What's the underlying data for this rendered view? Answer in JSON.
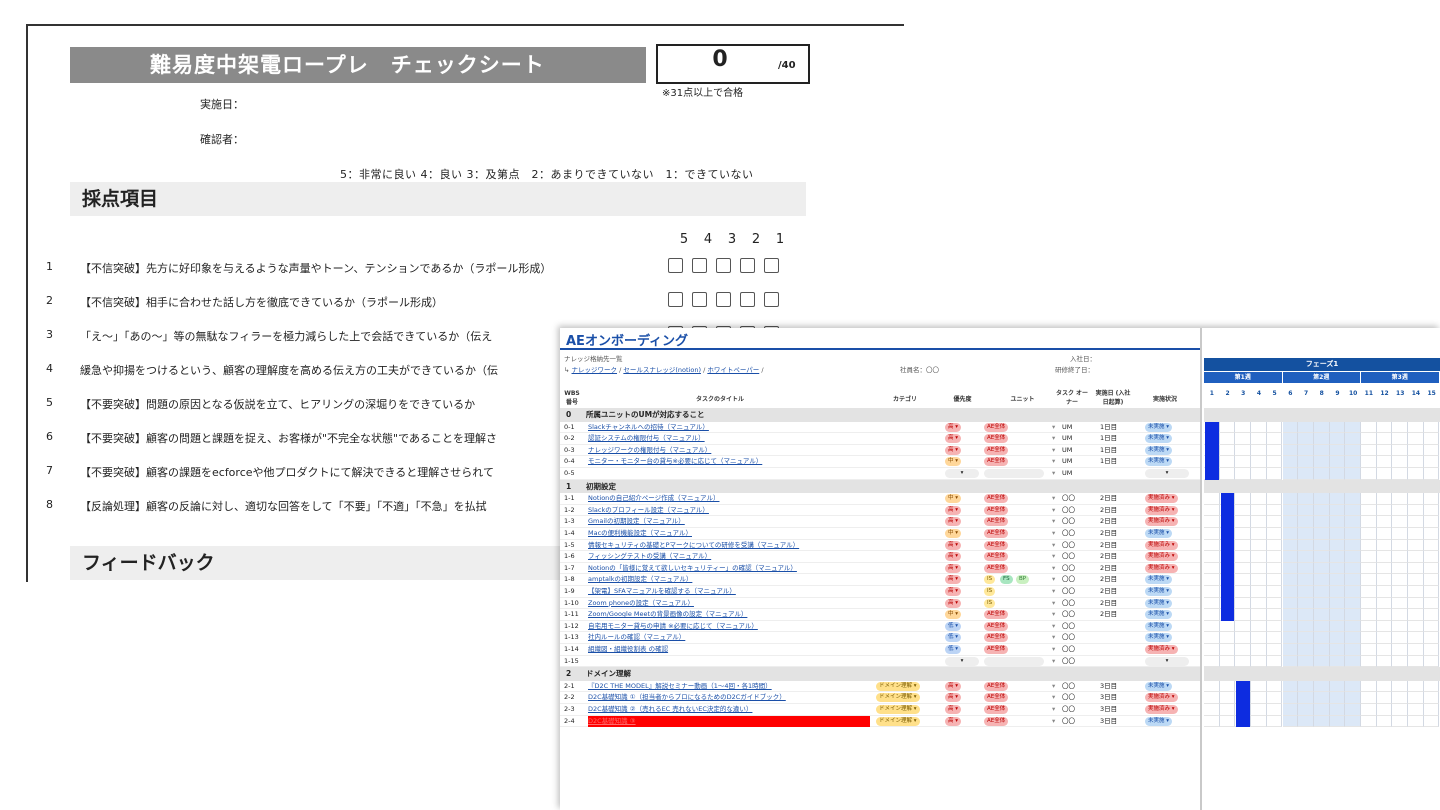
{
  "checksheet": {
    "title": "難易度中架電ロープレ　チェックシート",
    "score": "0",
    "score_max": "/40",
    "pass_note": "※31点以上で合格",
    "date_label": "実施日：",
    "checker_label": "確認者：",
    "scale_legend": "5：非常に良い 4：良い 3：及第点　2：あまりできていない　1：できていない",
    "section_scoring": "採点項目",
    "columns": [
      "5",
      "4",
      "3",
      "2",
      "1"
    ],
    "items": [
      {
        "no": "1",
        "text": "【不信突破】先方に好印象を与えるような声量やトーン、テンションであるか（ラポール形成）"
      },
      {
        "no": "2",
        "text": "【不信突破】相手に合わせた話し方を徹底できているか（ラポール形成）"
      },
      {
        "no": "3",
        "text": "「え〜」「あの〜」等の無駄なフィラーを極力減らした上で会話できているか（伝え"
      },
      {
        "no": "4",
        "text": "緩急や抑揚をつけるという、顧客の理解度を高める伝え方の工夫ができているか（伝"
      },
      {
        "no": "5",
        "text": "【不要突破】問題の原因となる仮説を立て、ヒアリングの深堀りをできているか"
      },
      {
        "no": "6",
        "text": "【不要突破】顧客の問題と課題を捉え、お客様が\"不完全な状態\"であることを理解さ"
      },
      {
        "no": "7",
        "text": "【不要突破】顧客の課題をecforceや他プロダクトにて解決できると理解させられて"
      },
      {
        "no": "8",
        "text": "【反論処理】顧客の反論に対し、適切な回答をして「不要」「不適」「不急」を払拭"
      }
    ],
    "section_feedback": "フィードバック"
  },
  "onboarding": {
    "title": "AEオンボーディング",
    "subtitle": "ナレッジ格納先一覧",
    "links": [
      {
        "label": "ナレッジワーク"
      },
      {
        "label": "セールスナレッジ(notion)"
      },
      {
        "label": "ホワイトペーパー"
      }
    ],
    "employee_label": "社員名：〇〇",
    "join_label": "入社日：",
    "training_end_label": "研修終了日：",
    "headers": {
      "wbs": "WBS 番号",
      "task": "タスクのタイトル",
      "category": "カテゴリ",
      "priority": "優先度",
      "unit": "ユニット",
      "owner": "タスク オーナー",
      "day": "実施日 (入社日起算)",
      "status": "実施状況"
    },
    "gantt": {
      "phase": "フェーズ1",
      "weeks": [
        "第1週",
        "第2週",
        "第3週"
      ],
      "days": [
        "1",
        "2",
        "3",
        "4",
        "5",
        "6",
        "7",
        "8",
        "9",
        "10",
        "11",
        "12",
        "13",
        "14",
        "15"
      ]
    },
    "groups": [
      {
        "no": "0",
        "title": "所属ユニットのUMが対応すること",
        "rows": [
          {
            "no": "0-1",
            "task": "Slackチャンネルへの招待（マニュアル）",
            "cat": "",
            "pri": "高",
            "units": [
              "AE全体"
            ],
            "owner": "UM",
            "day": "1日目",
            "status": "未実施",
            "bar": [
              0,
              1
            ]
          },
          {
            "no": "0-2",
            "task": "認証システムの権限付与（マニュアル）",
            "cat": "",
            "pri": "高",
            "units": [
              "AE全体"
            ],
            "owner": "UM",
            "day": "1日目",
            "status": "未実施",
            "bar": [
              0,
              1
            ]
          },
          {
            "no": "0-3",
            "task": "ナレッジワークの権限付与（マニュアル）",
            "cat": "",
            "pri": "高",
            "units": [
              "AE全体"
            ],
            "owner": "UM",
            "day": "1日目",
            "status": "未実施",
            "bar": [
              0,
              1
            ]
          },
          {
            "no": "0-4",
            "task": "モニター・モニター台の貸与※必要に応じて（マニュアル）",
            "cat": "",
            "pri": "中",
            "units": [
              "AE全体"
            ],
            "owner": "UM",
            "day": "1日目",
            "status": "未実施",
            "bar": [
              0,
              1
            ]
          },
          {
            "no": "0-5",
            "task": "",
            "cat": "",
            "pri": "",
            "units": [],
            "owner": "UM",
            "day": "",
            "status": "",
            "bar": [
              0,
              1
            ]
          }
        ]
      },
      {
        "no": "1",
        "title": "初期設定",
        "rows": [
          {
            "no": "1-1",
            "task": "Notionの自己紹介ページ作成（マニュアル）",
            "cat": "",
            "pri": "中",
            "units": [
              "AE全体"
            ],
            "owner": "〇〇",
            "day": "2日目",
            "status": "実施済み",
            "bar": [
              1,
              1
            ]
          },
          {
            "no": "1-2",
            "task": "Slackのプロフィール設定（マニュアル）",
            "cat": "",
            "pri": "高",
            "units": [
              "AE全体"
            ],
            "owner": "〇〇",
            "day": "2日目",
            "status": "実施済み",
            "bar": [
              1,
              1
            ]
          },
          {
            "no": "1-3",
            "task": "Gmailの初期設定（マニュアル）",
            "cat": "",
            "pri": "高",
            "units": [
              "AE全体"
            ],
            "owner": "〇〇",
            "day": "2日目",
            "status": "実施済み",
            "bar": [
              1,
              1
            ]
          },
          {
            "no": "1-4",
            "task": "Macの便利機能設定（マニュアル）",
            "cat": "",
            "pri": "中",
            "units": [
              "AE全体"
            ],
            "owner": "〇〇",
            "day": "2日目",
            "status": "未実施",
            "bar": [
              1,
              1
            ]
          },
          {
            "no": "1-5",
            "task": "情報セキュリティの基礎とPマークについての研修を受講（マニュアル）",
            "cat": "",
            "pri": "高",
            "units": [
              "AE全体"
            ],
            "owner": "〇〇",
            "day": "2日目",
            "status": "実施済み",
            "bar": [
              1,
              1
            ]
          },
          {
            "no": "1-6",
            "task": "フィッシングテストの受講（マニュアル）",
            "cat": "",
            "pri": "高",
            "units": [
              "AE全体"
            ],
            "owner": "〇〇",
            "day": "2日目",
            "status": "実施済み",
            "bar": [
              1,
              1
            ]
          },
          {
            "no": "1-7",
            "task": "Notionの「皆様に覚えて欲しいセキュリティー」の確認（マニュアル）",
            "cat": "",
            "pri": "高",
            "units": [
              "AE全体"
            ],
            "owner": "〇〇",
            "day": "2日目",
            "status": "実施済み",
            "bar": [
              1,
              1
            ]
          },
          {
            "no": "1-8",
            "task": "amptalkの初期設定（マニュアル）",
            "cat": "",
            "pri": "高",
            "units": [
              "IS",
              "FS",
              "BP"
            ],
            "owner": "〇〇",
            "day": "2日目",
            "status": "未実施",
            "bar": [
              1,
              1
            ]
          },
          {
            "no": "1-9",
            "task": "【架電】SFAマニュアルを確認する（マニュアル）",
            "cat": "",
            "pri": "高",
            "units": [
              "IS"
            ],
            "owner": "〇〇",
            "day": "2日目",
            "status": "未実施",
            "bar": [
              1,
              1
            ]
          },
          {
            "no": "1-10",
            "task": "Zoom phoneの設定（マニュアル）",
            "cat": "",
            "pri": "高",
            "units": [
              "IS"
            ],
            "owner": "〇〇",
            "day": "2日目",
            "status": "未実施",
            "bar": [
              1,
              1
            ]
          },
          {
            "no": "1-11",
            "task": "Zoom/Google Meetの背景画像の設定（マニュアル）",
            "cat": "",
            "pri": "中",
            "units": [
              "AE全体"
            ],
            "owner": "〇〇",
            "day": "2日目",
            "status": "未実施",
            "bar": [
              1,
              1
            ]
          },
          {
            "no": "1-12",
            "task": "自宅用モニター貸与の申請 ※必要に応じて（マニュアル）",
            "cat": "",
            "pri": "低",
            "units": [
              "AE全体"
            ],
            "owner": "〇〇",
            "day": "",
            "status": "未実施",
            "bar": null
          },
          {
            "no": "1-13",
            "task": "社内ルールの確認（マニュアル）",
            "cat": "",
            "pri": "低",
            "units": [
              "AE全体"
            ],
            "owner": "〇〇",
            "day": "",
            "status": "未実施",
            "bar": null
          },
          {
            "no": "1-14",
            "task": "組織図・組織役割表 の確認",
            "cat": "",
            "pri": "低",
            "units": [
              "AE全体"
            ],
            "owner": "〇〇",
            "day": "",
            "status": "実施済み",
            "bar": null
          },
          {
            "no": "1-15",
            "task": "",
            "cat": "",
            "pri": "",
            "units": [],
            "owner": "〇〇",
            "day": "",
            "status": "",
            "bar": null
          }
        ]
      },
      {
        "no": "2",
        "title": "ドメイン理解",
        "rows": [
          {
            "no": "2-1",
            "task": "『D2C THE MODEL』解説セミナー動画（1〜4回・各1時間）",
            "cat": "ドメイン理解",
            "pri": "高",
            "units": [
              "AE全体"
            ],
            "owner": "〇〇",
            "day": "3日目",
            "status": "未実施",
            "bar": [
              2,
              1
            ]
          },
          {
            "no": "2-2",
            "task": "D2C基礎知識 ①（担当者からプロになるためのD2Cガイドブック）",
            "cat": "ドメイン理解",
            "pri": "高",
            "units": [
              "AE全体"
            ],
            "owner": "〇〇",
            "day": "3日目",
            "status": "実施済み",
            "bar": [
              2,
              1
            ]
          },
          {
            "no": "2-3",
            "task": "D2C基礎知識 ②（売れるEC 売れないEC決定的な違い）",
            "cat": "ドメイン理解",
            "pri": "高",
            "units": [
              "AE全体"
            ],
            "owner": "〇〇",
            "day": "3日目",
            "status": "実施済み",
            "bar": [
              2,
              1
            ]
          },
          {
            "no": "2-4",
            "task": "D2C基礎知識 ③",
            "cat": "ドメイン理解",
            "pri": "高",
            "units": [
              "AE全体"
            ],
            "owner": "〇〇",
            "day": "3日目",
            "status": "未実施",
            "bar": [
              2,
              1
            ]
          }
        ]
      }
    ]
  }
}
